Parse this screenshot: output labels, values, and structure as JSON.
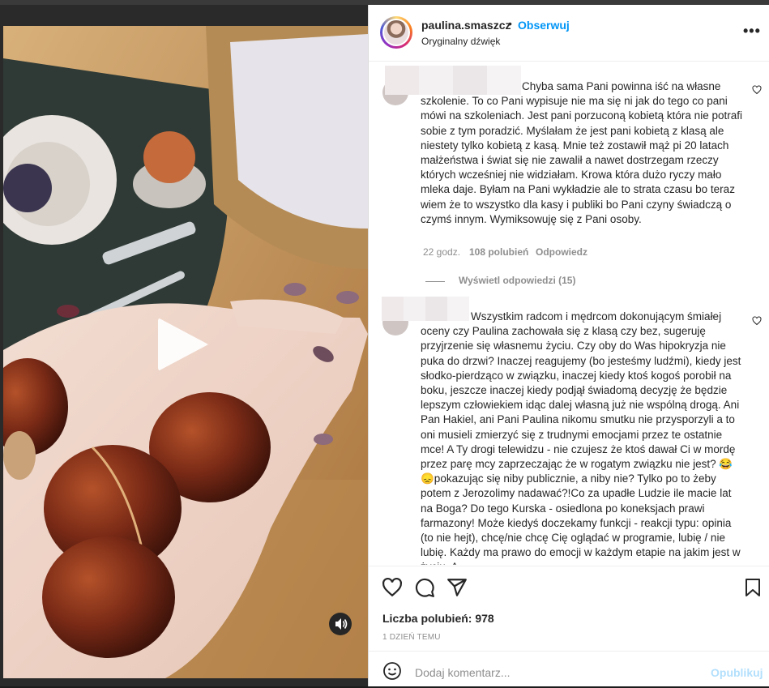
{
  "header": {
    "username": "paulina.smaszcz",
    "follow_label": "Obserwuj",
    "subtitle": "Oryginalny dźwięk"
  },
  "comments": [
    {
      "text": "Chyba sama Pani powinna iść na własne szkolenie. To co Pani wypisuje nie ma się ni jak do tego co pani mówi na szkoleniach. Jest pani porzuconą kobietą która nie potrafi sobie z tym poradzić. Myślałam że jest pani kobietą z klasą ale niestety tylko kobietą z kasą. Mnie też zostawił mąż pi 20 latach małżeństwa i świat się nie zawalił a nawet dostrzegam rzeczy których wcześniej nie widziałam. Krowa która dużo ryczy mało mleka daje. Byłam na Pani wykładzie ale to strata czasu bo teraz wiem że to wszystko dla kasy i publiki bo Pani czyny świadczą o czymś innym. Wymiksowuję się z Pani osoby.",
      "time": "22 godz.",
      "likes": "108 polubień",
      "reply": "Odpowiedz",
      "view_replies": "Wyświetl odpowiedzi (15)"
    },
    {
      "text": "Wszystkim radcom i mędrcom dokonującym śmiałej oceny czy Paulina zachowała się z klasą czy bez, sugeruję przyjrzenie się własnemu życiu. Czy oby do Was hipokryzja nie puka do drzwi? Inaczej reagujemy (bo jesteśmy ludźmi), kiedy jest słodko-pierdząco w związku, inaczej kiedy ktoś kogoś porobił na boku, jeszcze inaczej kiedy podjął świadomą decyzję że będzie lepszym człowiekiem idąc dalej własną już nie wspólną drogą. Ani Pan Hakiel, ani Pani Paulina nikomu smutku nie przysporzyli a to oni musieli zmierzyć się z trudnymi emocjami przez te ostatnie mce! A Ty drogi telewidzu - nie czujesz że ktoś dawał Ci w mordę przez parę mcy zaprzeczając że w rogatym związku nie jest? 😂😞pokazując się niby publicznie, a niby nie? Tylko po to żeby potem z Jerozolimy nadawać?!Co za upadłe Ludzie ile macie lat na Boga? Do tego Kurska - osiedlona po koneksjach prawi farmazony! Może kiedyś doczekamy funkcji - reakcji typu: opinia (to nie hejt), chcę/nie chcę Cię oglądać w programie, lubię / nie lubię. Każdy ma prawo do emocji w każdym etapie na jakim jest w życiu. A"
    }
  ],
  "post": {
    "likes_text": "Liczba polubień: 978",
    "posted": "1 DZIEŃ TEMU",
    "comment_placeholder": "Dodaj komentarz...",
    "publish_label": "Opublikuj"
  },
  "colors": {
    "accent": "#0095f6",
    "publish_disabled": "#b2dffc",
    "muted": "#8e8e8e",
    "text": "#262626"
  },
  "icons": [
    "play-icon",
    "sound-icon",
    "heart-icon",
    "comment-icon",
    "share-icon",
    "bookmark-icon",
    "emoji-icon",
    "more-icon"
  ]
}
